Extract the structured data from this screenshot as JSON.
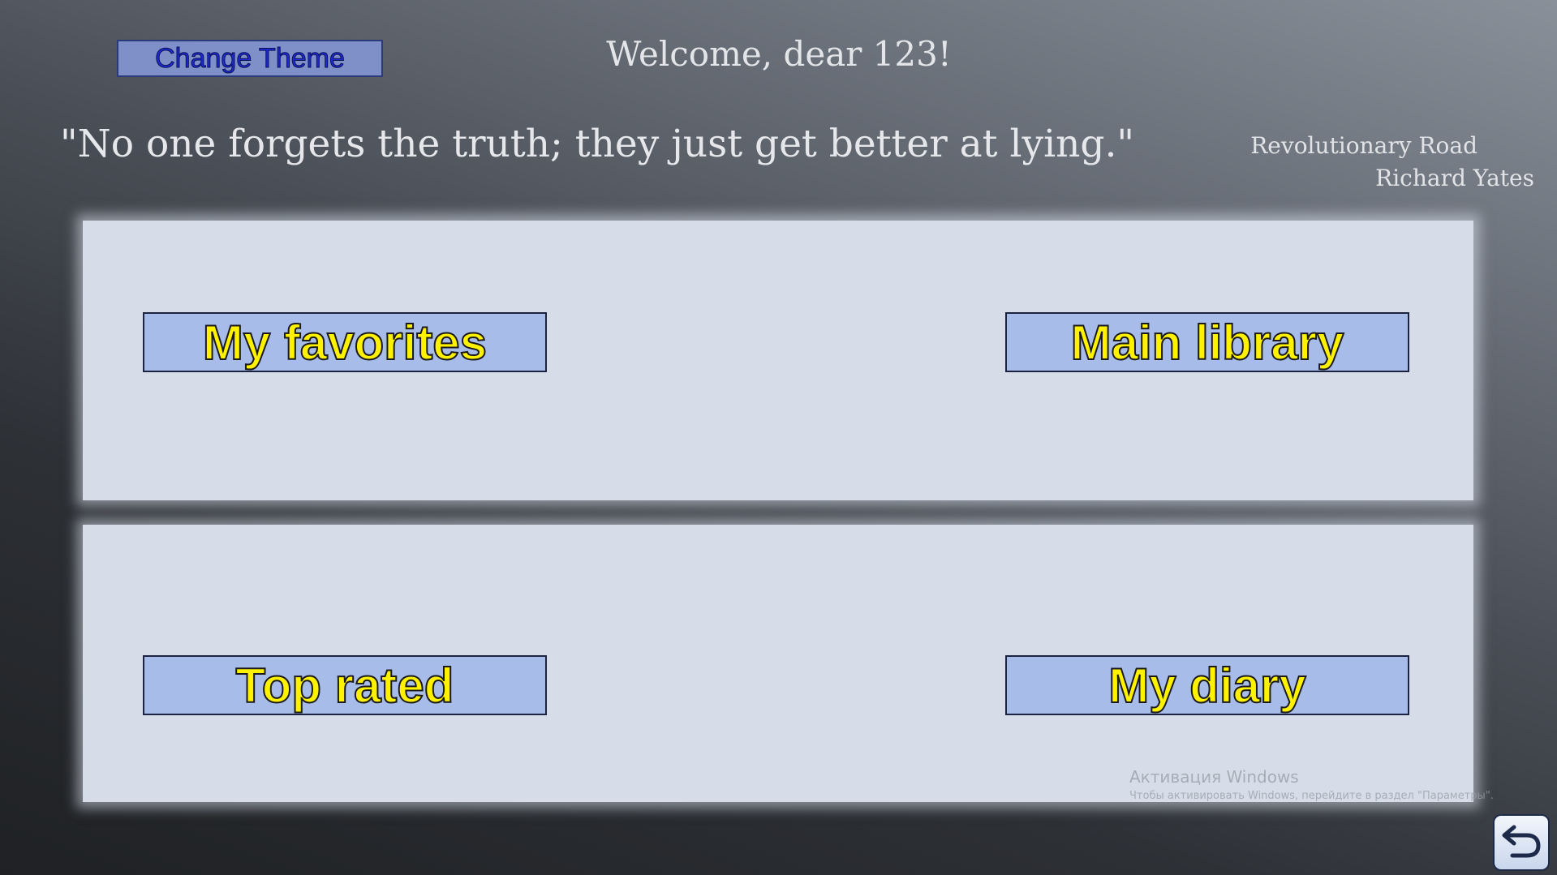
{
  "header": {
    "theme_button_label": "Change Theme",
    "welcome_text": "Welcome, dear 123!"
  },
  "quote": {
    "text": "\"No one forgets the truth; they just get better at lying.\"",
    "book": "Revolutionary Road",
    "author": "Richard Yates"
  },
  "menu": {
    "favorites_label": "My favorites",
    "library_label": "Main library",
    "top_rated_label": "Top rated",
    "diary_label": "My diary"
  },
  "watermark": {
    "title": "Активация Windows",
    "subtitle": "Чтобы активировать Windows, перейдите в раздел \"Параметры\"."
  },
  "icons": {
    "back": "back-arrow-icon"
  },
  "colors": {
    "button_fill": "#a8bcea",
    "button_text": "#fff200",
    "panel": "#d6dde8",
    "theme_button_fill": "#7e90c7",
    "theme_button_text": "#1e2ad8"
  }
}
